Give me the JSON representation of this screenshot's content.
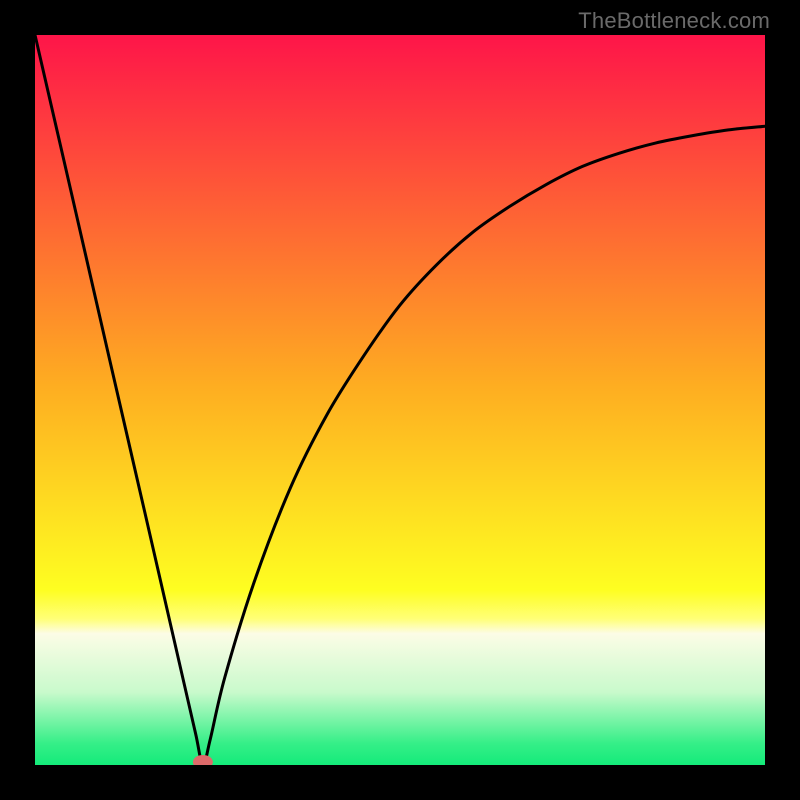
{
  "watermark": "TheBottleneck.com",
  "chart_data": {
    "type": "line",
    "title": "",
    "xlabel": "",
    "ylabel": "",
    "xlim": [
      0,
      100
    ],
    "ylim": [
      0,
      100
    ],
    "grid": false,
    "minimum_x": 23,
    "marker": {
      "x": 23,
      "y": 0,
      "color": "#dd6a6a"
    },
    "series": [
      {
        "name": "bottleneck-curve",
        "color": "#000000",
        "x": [
          0,
          5,
          10,
          15,
          20,
          22,
          23,
          24,
          26,
          30,
          35,
          40,
          45,
          50,
          55,
          60,
          65,
          70,
          75,
          80,
          85,
          90,
          95,
          100
        ],
        "y": [
          100,
          78.3,
          56.5,
          34.8,
          13.0,
          4.3,
          0,
          3.5,
          12.0,
          25.0,
          38.0,
          48.0,
          56.0,
          63.0,
          68.5,
          73.0,
          76.5,
          79.5,
          82.0,
          83.8,
          85.2,
          86.2,
          87.0,
          87.5
        ]
      }
    ],
    "background_gradient_stops": [
      {
        "offset": 0.0,
        "color": "#fe1549"
      },
      {
        "offset": 0.48,
        "color": "#fead21"
      },
      {
        "offset": 0.76,
        "color": "#fefe21"
      },
      {
        "offset": 0.8,
        "color": "#ffff78"
      },
      {
        "offset": 0.82,
        "color": "#fcfce6"
      },
      {
        "offset": 0.9,
        "color": "#c9facc"
      },
      {
        "offset": 0.97,
        "color": "#36ef88"
      },
      {
        "offset": 1.0,
        "color": "#14eb7a"
      }
    ]
  }
}
